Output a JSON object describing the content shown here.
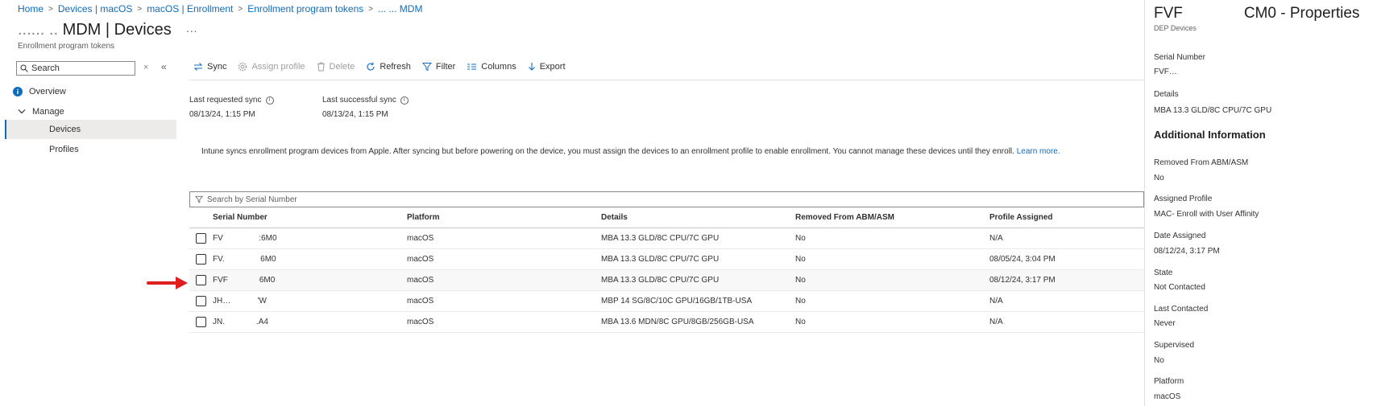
{
  "breadcrumb": {
    "items": [
      "Home",
      "Devices | macOS",
      "macOS | Enrollment",
      "Enrollment program tokens"
    ],
    "last_partial": "... ... MDM"
  },
  "header": {
    "title_prefix": "...... ..",
    "title": "MDM | Devices",
    "more": "···",
    "subtitle": "Enrollment program tokens"
  },
  "sidebar": {
    "search_placeholder": "Search",
    "clear": "×",
    "collapse": "«",
    "overview": "Overview",
    "manage": "Manage",
    "devices": "Devices",
    "profiles": "Profiles"
  },
  "toolbar": {
    "sync": "Sync",
    "assign_profile": "Assign profile",
    "delete": "Delete",
    "refresh": "Refresh",
    "filter": "Filter",
    "columns": "Columns",
    "export": "Export"
  },
  "sync_info": {
    "last_requested_label": "Last requested sync",
    "last_requested_value": "08/13/24, 1:15 PM",
    "last_successful_label": "Last successful sync",
    "last_successful_value": "08/13/24, 1:15 PM",
    "info_glyph": "i"
  },
  "notice": {
    "text": "Intune syncs enrollment program devices from Apple. After syncing but before powering on the device, you must assign the devices to an enrollment profile to enable enrollment. You cannot manage these devices until they enroll.",
    "link": "Learn more."
  },
  "grid": {
    "search_placeholder": "Search by Serial Number",
    "columns": [
      "Serial Number",
      "Platform",
      "Details",
      "Removed From ABM/ASM",
      "Profile Assigned"
    ],
    "rows": [
      {
        "serial": "FV        :6M0",
        "platform": "macOS",
        "details": "MBA 13.3 GLD/8C CPU/7C GPU",
        "removed": "No",
        "profile": "N/A"
      },
      {
        "serial": "FV.        6M0",
        "platform": "macOS",
        "details": "MBA 13.3 GLD/8C CPU/7C GPU",
        "removed": "No",
        "profile": "08/05/24, 3:04 PM"
      },
      {
        "serial": "FVF       6M0",
        "platform": "macOS",
        "details": "MBA 13.3 GLD/8C CPU/7C GPU",
        "removed": "No",
        "profile": "08/12/24, 3:17 PM"
      },
      {
        "serial": "JH…      'W",
        "platform": "macOS",
        "details": "MBP 14 SG/8C/10C GPU/16GB/1TB-USA",
        "removed": "No",
        "profile": "N/A"
      },
      {
        "serial": "JN.       .A4",
        "platform": "macOS",
        "details": "MBA 13.6 MDN/8C GPU/8GB/256GB-USA",
        "removed": "No",
        "profile": "N/A"
      }
    ]
  },
  "panel": {
    "title_prefix": "FVF",
    "title": "CM0 - Properties",
    "subtitle": "DEP Devices",
    "serial_label": "Serial Number",
    "serial_value": "FVF…",
    "details_label": "Details",
    "details_value": "MBA 13.3 GLD/8C CPU/7C GPU",
    "section": "Additional Information",
    "fields": [
      {
        "label": "Removed From ABM/ASM",
        "value": "No"
      },
      {
        "label": "Assigned Profile",
        "value": "MAC- Enroll with User Affinity"
      },
      {
        "label": "Date Assigned",
        "value": "08/12/24, 3:17 PM"
      },
      {
        "label": "State",
        "value": "Not Contacted"
      },
      {
        "label": "Last Contacted",
        "value": "Never"
      },
      {
        "label": "Supervised",
        "value": "No"
      },
      {
        "label": "Platform",
        "value": "macOS"
      }
    ]
  },
  "colors": {
    "link": "#0f6cbd",
    "arrow": "#e01e1e",
    "active_nav": "#edebe9"
  }
}
